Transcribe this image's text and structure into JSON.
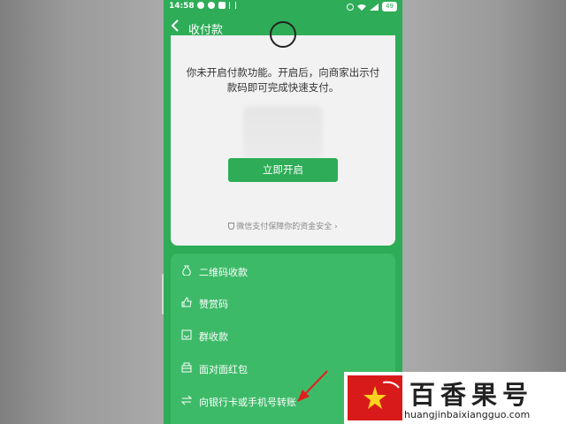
{
  "status_bar": {
    "time": "14:58",
    "battery": "49"
  },
  "header": {
    "back_icon": "chevron-left-icon",
    "title": "收付款"
  },
  "card": {
    "description": "你未开启付款功能。开启后，向商家出示付款码即可完成快速支付。",
    "enable_button": "立即开启",
    "security_text": "微信支付保障你的资金安全",
    "security_icon": "shield-icon"
  },
  "menu": {
    "items": [
      {
        "label": "二维码收款",
        "icon": "money-bag-icon"
      },
      {
        "label": "赞赏码",
        "icon": "thumbs-up-icon"
      },
      {
        "label": "群收款",
        "icon": "group-bill-icon"
      },
      {
        "label": "面对面红包",
        "icon": "red-packet-icon"
      },
      {
        "label": "向银行卡或手机号转账",
        "icon": "transfer-arrows-icon"
      }
    ]
  },
  "watermark": {
    "title": "百香果号",
    "url": "huangjinbaixiangguo.com"
  },
  "colors": {
    "brand_green": "#2eac57",
    "menu_green": "#3dba68",
    "arrow_red": "#e02020"
  }
}
